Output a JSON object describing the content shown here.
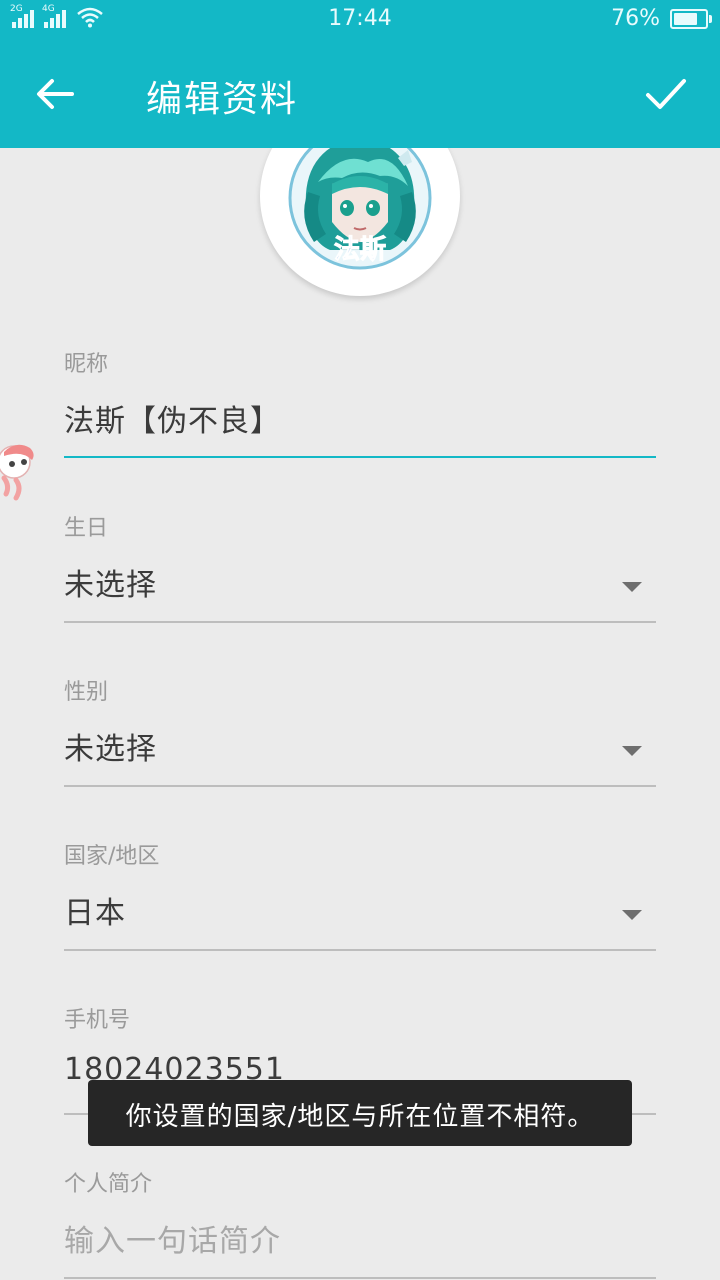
{
  "status_bar": {
    "signal_1_label": "2G",
    "signal_2_label": "4G",
    "time": "17:44",
    "battery_percent": "76%",
    "battery_level": 0.76
  },
  "app_bar": {
    "title": "编辑资料",
    "background_color": "#13b8c6",
    "back_icon": "arrow-left-icon",
    "confirm_icon": "check-icon"
  },
  "avatar": {
    "badge_text": "法斯"
  },
  "form": {
    "nickname": {
      "label": "昵称",
      "value": "法斯【伪不良】"
    },
    "birthday": {
      "label": "生日",
      "value": "未选择"
    },
    "gender": {
      "label": "性别",
      "value": "未选择"
    },
    "region": {
      "label": "国家/地区",
      "value": "日本"
    },
    "phone": {
      "label": "手机号",
      "value": "18024023551"
    },
    "bio": {
      "label": "个人简介",
      "placeholder": "输入一句话简介"
    }
  },
  "toast": {
    "message": "你设置的国家/地区与所在位置不相符。"
  }
}
